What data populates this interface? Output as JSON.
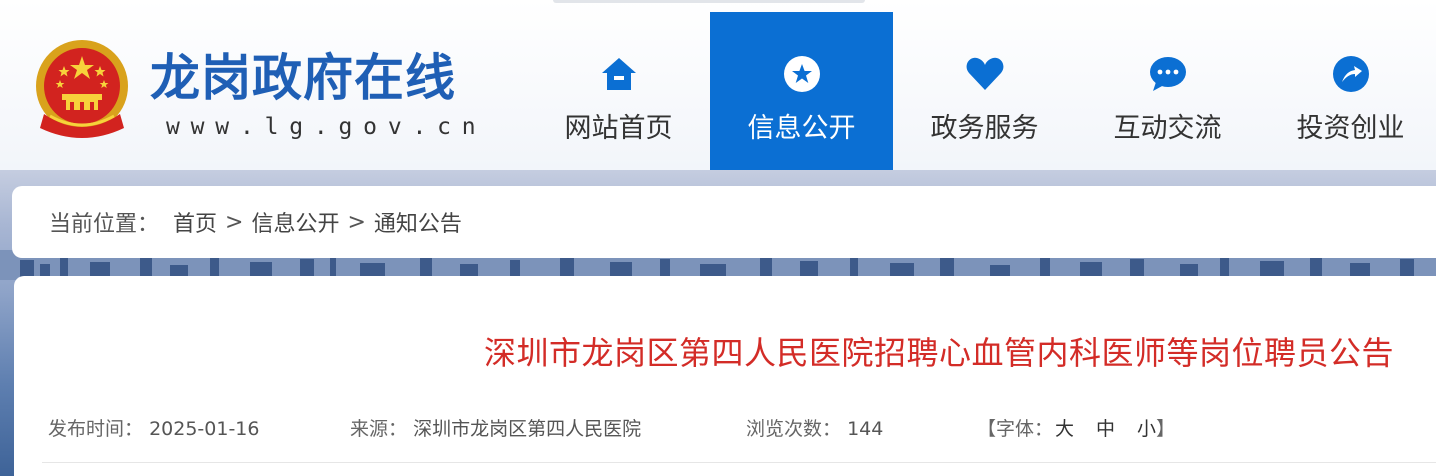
{
  "header": {
    "site_title": "龙岗政府在线",
    "site_url": "www.lg.gov.cn",
    "brand_color": "#1f5fb5",
    "nav_active_color": "#0b6fd3"
  },
  "nav": {
    "items": [
      {
        "label": "网站首页",
        "icon": "home-icon"
      },
      {
        "label": "信息公开",
        "icon": "star-icon",
        "active": true
      },
      {
        "label": "政务服务",
        "icon": "heart-icon"
      },
      {
        "label": "互动交流",
        "icon": "chat-icon"
      },
      {
        "label": "投资创业",
        "icon": "arrow-icon"
      }
    ]
  },
  "breadcrumb": {
    "label": "当前位置：",
    "items": [
      "首页",
      "信息公开",
      "通知公告"
    ],
    "separator": ">"
  },
  "article": {
    "title": "深圳市龙岗区第四人民医院招聘心血管内科医师等岗位聘员公告",
    "title_color": "#d32c27",
    "publish_label": "发布时间：",
    "publish_date": "2025-01-16",
    "source_label": "来源：",
    "source": "深圳市龙岗区第四人民医院",
    "views_label": "浏览次数：",
    "views": "144",
    "font_open": "【字体：",
    "font_large": "大",
    "font_medium": "中",
    "font_small": "小",
    "font_close": "】"
  }
}
